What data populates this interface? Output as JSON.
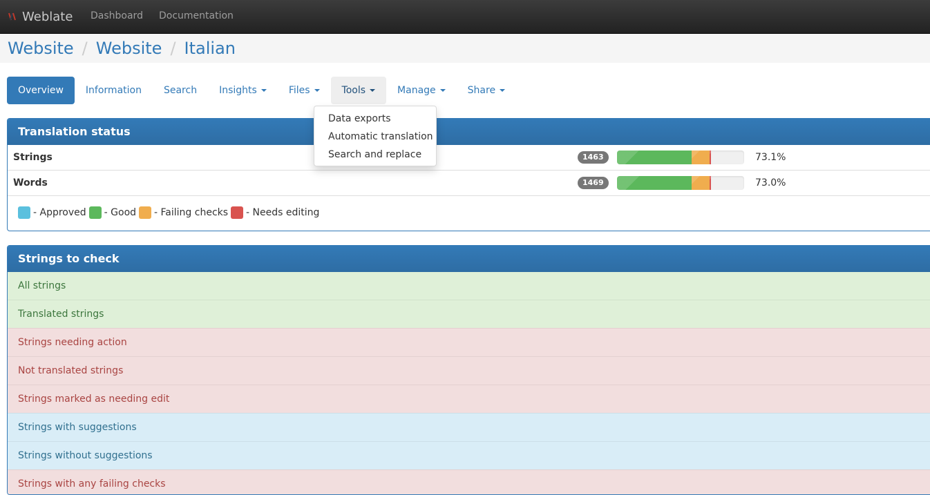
{
  "navbar": {
    "brand": "Weblate",
    "links": [
      "Dashboard",
      "Documentation"
    ]
  },
  "breadcrumb": [
    "Website",
    "Website",
    "Italian"
  ],
  "tabs": [
    {
      "label": "Overview",
      "active": true,
      "dropdown": false
    },
    {
      "label": "Information",
      "dropdown": false
    },
    {
      "label": "Search",
      "dropdown": false
    },
    {
      "label": "Insights",
      "dropdown": true
    },
    {
      "label": "Files",
      "dropdown": true
    },
    {
      "label": "Tools",
      "dropdown": true,
      "open": true
    },
    {
      "label": "Manage",
      "dropdown": true
    },
    {
      "label": "Share",
      "dropdown": true
    }
  ],
  "tools_menu": {
    "items": [
      "Data exports",
      "Automatic translation",
      "Search and replace"
    ]
  },
  "translation_status": {
    "title": "Translation status",
    "rows": [
      {
        "label": "Strings",
        "count": "1463",
        "percent": "73.1%",
        "progress": {
          "good": 58.5,
          "failing": 14.6,
          "needs_edit": 1.0
        }
      },
      {
        "label": "Words",
        "count": "1469",
        "percent": "73.0%",
        "progress": {
          "good": 58.5,
          "failing": 14.5,
          "needs_edit": 1.0
        }
      }
    ],
    "legend": [
      {
        "label": "- Approved",
        "color": "#5bc0de"
      },
      {
        "label": "- Good",
        "color": "#5cb85c"
      },
      {
        "label": "- Failing checks",
        "color": "#f0ad4e"
      },
      {
        "label": "- Needs editing",
        "color": "#d9534f"
      }
    ]
  },
  "strings_to_check": {
    "title": "Strings to check",
    "items": [
      {
        "label": "All strings",
        "kind": "success"
      },
      {
        "label": "Translated strings",
        "kind": "success"
      },
      {
        "label": "Strings needing action",
        "kind": "danger"
      },
      {
        "label": "Not translated strings",
        "kind": "danger"
      },
      {
        "label": "Strings marked as needing edit",
        "kind": "danger"
      },
      {
        "label": "Strings with suggestions",
        "kind": "info"
      },
      {
        "label": "Strings without suggestions",
        "kind": "info"
      },
      {
        "label": "Strings with any failing checks",
        "kind": "danger"
      }
    ]
  },
  "colors": {
    "primary": "#337ab7",
    "success_bg": "#dff0d8",
    "success_text": "#3c763d",
    "danger_bg": "#f2dede",
    "danger_text": "#a94442",
    "info_bg": "#d9edf7",
    "info_text": "#31708f",
    "bar_good": "#5cb85c",
    "bar_failing": "#f0ad4e",
    "bar_needs_edit": "#d9534f"
  }
}
